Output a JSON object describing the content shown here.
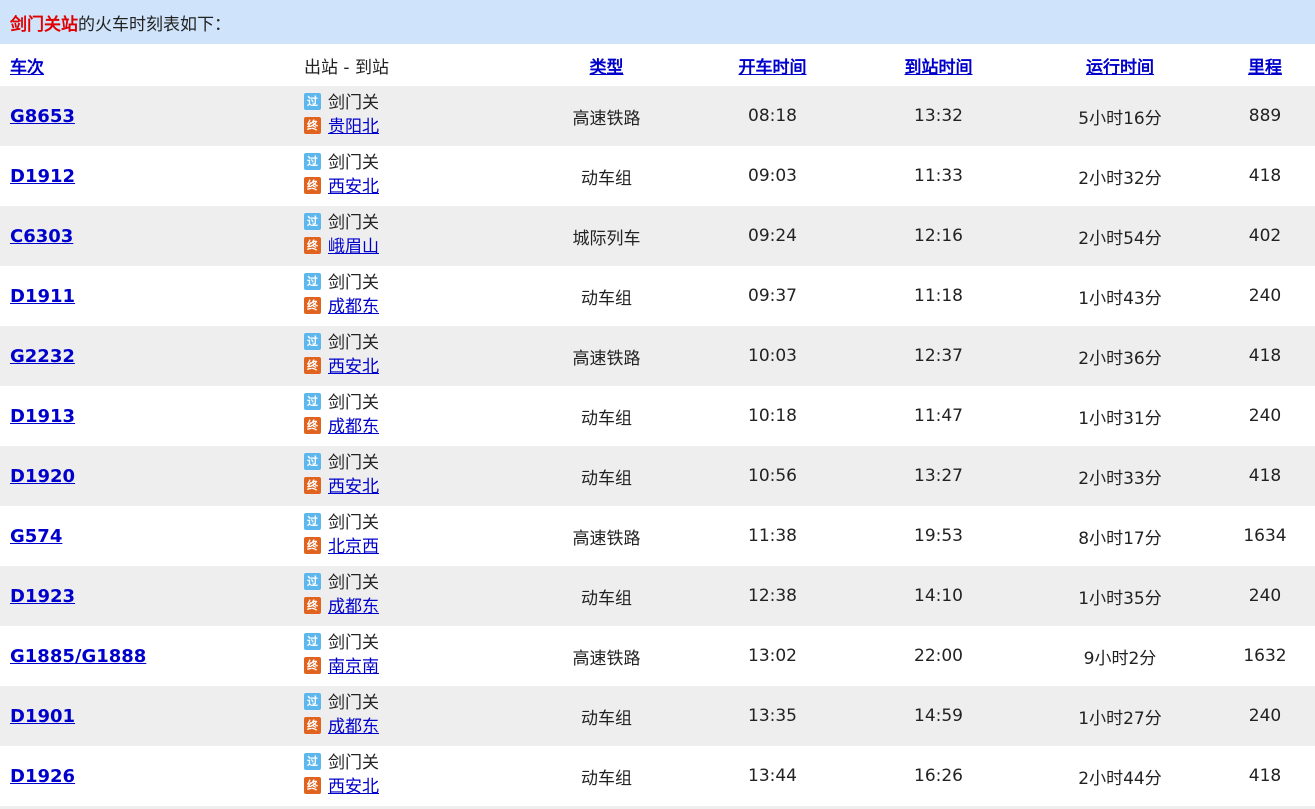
{
  "title": {
    "station": "剑门关站",
    "suffix": "的火车时刻表如下："
  },
  "headers": {
    "train_no": "车次",
    "route": "出站 - 到站",
    "type": "类型",
    "depart": "开车时间",
    "arrive": "到站时间",
    "duration": "运行时间",
    "distance": "里程"
  },
  "badges": {
    "pass": "过",
    "end": "终"
  },
  "rows": [
    {
      "train": "G8653",
      "from": "剑门关",
      "to": "贵阳北",
      "type": "高速铁路",
      "depart": "08:18",
      "arrive": "13:32",
      "duration": "5小时16分",
      "distance": "889"
    },
    {
      "train": "D1912",
      "from": "剑门关",
      "to": "西安北",
      "type": "动车组",
      "depart": "09:03",
      "arrive": "11:33",
      "duration": "2小时32分",
      "distance": "418"
    },
    {
      "train": "C6303",
      "from": "剑门关",
      "to": "峨眉山",
      "type": "城际列车",
      "depart": "09:24",
      "arrive": "12:16",
      "duration": "2小时54分",
      "distance": "402"
    },
    {
      "train": "D1911",
      "from": "剑门关",
      "to": "成都东",
      "type": "动车组",
      "depart": "09:37",
      "arrive": "11:18",
      "duration": "1小时43分",
      "distance": "240"
    },
    {
      "train": "G2232",
      "from": "剑门关",
      "to": "西安北",
      "type": "高速铁路",
      "depart": "10:03",
      "arrive": "12:37",
      "duration": "2小时36分",
      "distance": "418"
    },
    {
      "train": "D1913",
      "from": "剑门关",
      "to": "成都东",
      "type": "动车组",
      "depart": "10:18",
      "arrive": "11:47",
      "duration": "1小时31分",
      "distance": "240"
    },
    {
      "train": "D1920",
      "from": "剑门关",
      "to": "西安北",
      "type": "动车组",
      "depart": "10:56",
      "arrive": "13:27",
      "duration": "2小时33分",
      "distance": "418"
    },
    {
      "train": "G574",
      "from": "剑门关",
      "to": "北京西",
      "type": "高速铁路",
      "depart": "11:38",
      "arrive": "19:53",
      "duration": "8小时17分",
      "distance": "1634"
    },
    {
      "train": "D1923",
      "from": "剑门关",
      "to": "成都东",
      "type": "动车组",
      "depart": "12:38",
      "arrive": "14:10",
      "duration": "1小时35分",
      "distance": "240"
    },
    {
      "train": "G1885/G1888",
      "from": "剑门关",
      "to": "南京南",
      "type": "高速铁路",
      "depart": "13:02",
      "arrive": "22:00",
      "duration": "9小时2分",
      "distance": "1632"
    },
    {
      "train": "D1901",
      "from": "剑门关",
      "to": "成都东",
      "type": "动车组",
      "depart": "13:35",
      "arrive": "14:59",
      "duration": "1小时27分",
      "distance": "240"
    },
    {
      "train": "D1926",
      "from": "剑门关",
      "to": "西安北",
      "type": "动车组",
      "depart": "13:44",
      "arrive": "16:26",
      "duration": "2小时44分",
      "distance": "418"
    }
  ]
}
